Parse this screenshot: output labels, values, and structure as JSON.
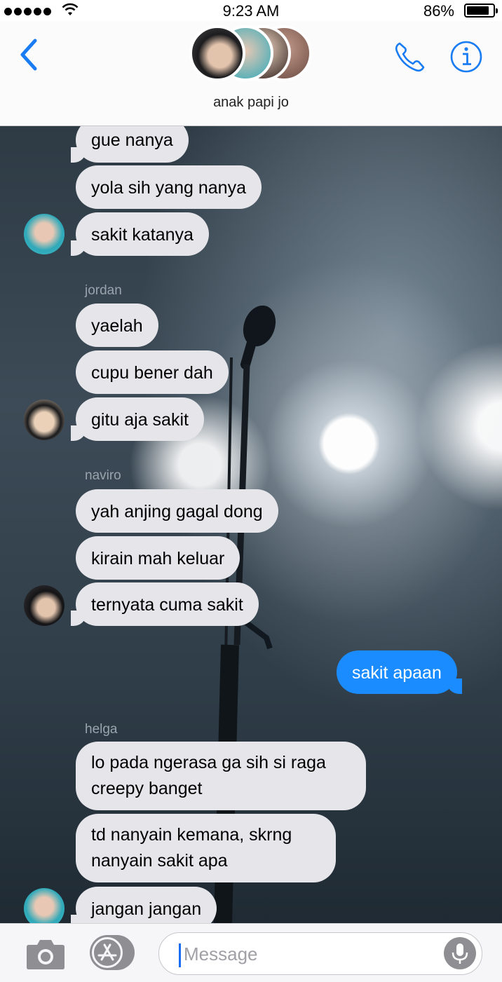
{
  "status_bar": {
    "time": "9:23 AM",
    "battery": "86%",
    "battery_level": 0.86
  },
  "header": {
    "group_name": "anak papi jo",
    "icons": [
      "back-chevron-icon",
      "phone-icon",
      "info-icon"
    ]
  },
  "messages": [
    {
      "text": "gue nanya"
    },
    {
      "text": "yola sih yang nanya"
    },
    {
      "text": "sakit katanya"
    },
    {
      "sender": "jordan"
    },
    {
      "text": "yaelah"
    },
    {
      "text": "cupu bener dah"
    },
    {
      "text": "gitu aja sakit"
    },
    {
      "sender": "naviro"
    },
    {
      "text": "yah anjing gagal dong"
    },
    {
      "text": "kirain mah keluar"
    },
    {
      "text": "ternyata cuma sakit"
    },
    {
      "text": "sakit apaan",
      "outgoing": true
    },
    {
      "sender": "helga"
    },
    {
      "text": "lo pada ngerasa ga sih si raga creepy banget"
    },
    {
      "text": "td nanyain kemana, skrng nanyain sakit apa"
    },
    {
      "text": "jangan jangan"
    }
  ],
  "input": {
    "placeholder": "Message"
  },
  "colors": {
    "ios_blue": "#1a8cff",
    "incoming_bubble": "#e5e5ea"
  }
}
